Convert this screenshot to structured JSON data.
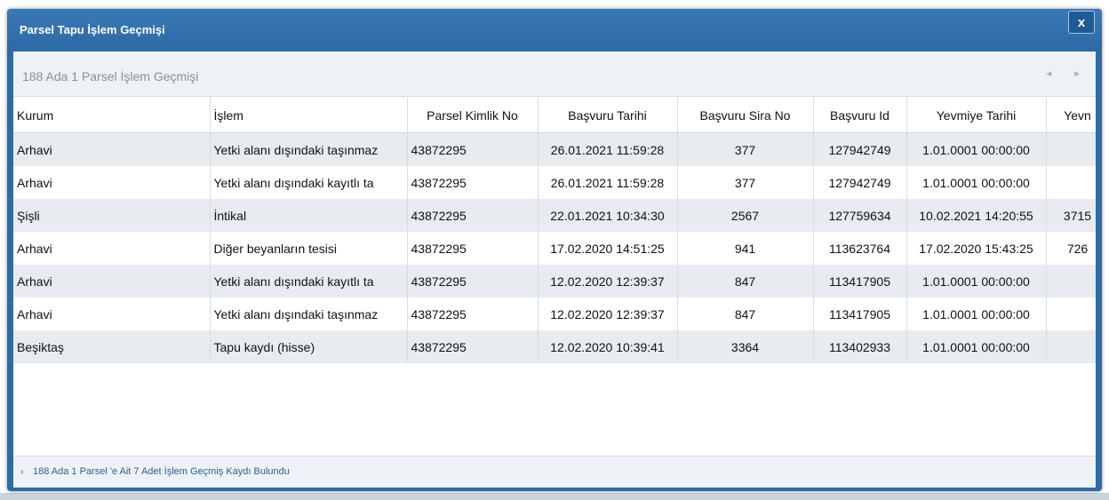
{
  "window": {
    "title": "Parsel Tapu İşlem Geçmişi",
    "close_label": "x"
  },
  "panel": {
    "title": "188 Ada 1 Parsel  İşlem Geçmişi",
    "prev_icon": "◄",
    "next_icon": "►"
  },
  "table": {
    "columns": [
      "Kurum",
      "İşlem",
      "Parsel Kimlik No",
      "Başvuru Tarihi",
      "Başvuru Sira No",
      "Başvuru Id",
      "Yevmiye Tarihi",
      "Yevn"
    ],
    "rows": [
      [
        "Arhavi",
        "Yetki alanı dışındaki taşınmaz",
        "43872295",
        "26.01.2021 11:59:28",
        "377",
        "127942749",
        "1.01.0001 00:00:00",
        ""
      ],
      [
        "Arhavi",
        "Yetki alanı dışındaki kayıtlı ta",
        "43872295",
        "26.01.2021 11:59:28",
        "377",
        "127942749",
        "1.01.0001 00:00:00",
        ""
      ],
      [
        "Şişli",
        "İntikal",
        "43872295",
        "22.01.2021 10:34:30",
        "2567",
        "127759634",
        "10.02.2021 14:20:55",
        "3715"
      ],
      [
        "Arhavi",
        "Diğer beyanların tesisi",
        "43872295",
        "17.02.2020 14:51:25",
        "941",
        "113623764",
        "17.02.2020 15:43:25",
        "726"
      ],
      [
        "Arhavi",
        "Yetki alanı dışındaki kayıtlı ta",
        "43872295",
        "12.02.2020 12:39:37",
        "847",
        "113417905",
        "1.01.0001 00:00:00",
        ""
      ],
      [
        "Arhavi",
        "Yetki alanı dışındaki taşınmaz",
        "43872295",
        "12.02.2020 12:39:37",
        "847",
        "113417905",
        "1.01.0001 00:00:00",
        ""
      ],
      [
        "Beşiktaş",
        "Tapu kaydı (hisse)",
        "43872295",
        "12.02.2020 10:39:41",
        "3364",
        "113402933",
        "1.01.0001 00:00:00",
        ""
      ]
    ]
  },
  "footer": {
    "icon": "›",
    "text": "188 Ada 1 Parsel 'e Ait 7 Adet İşlem Geçmiş Kaydı Bulundu"
  }
}
